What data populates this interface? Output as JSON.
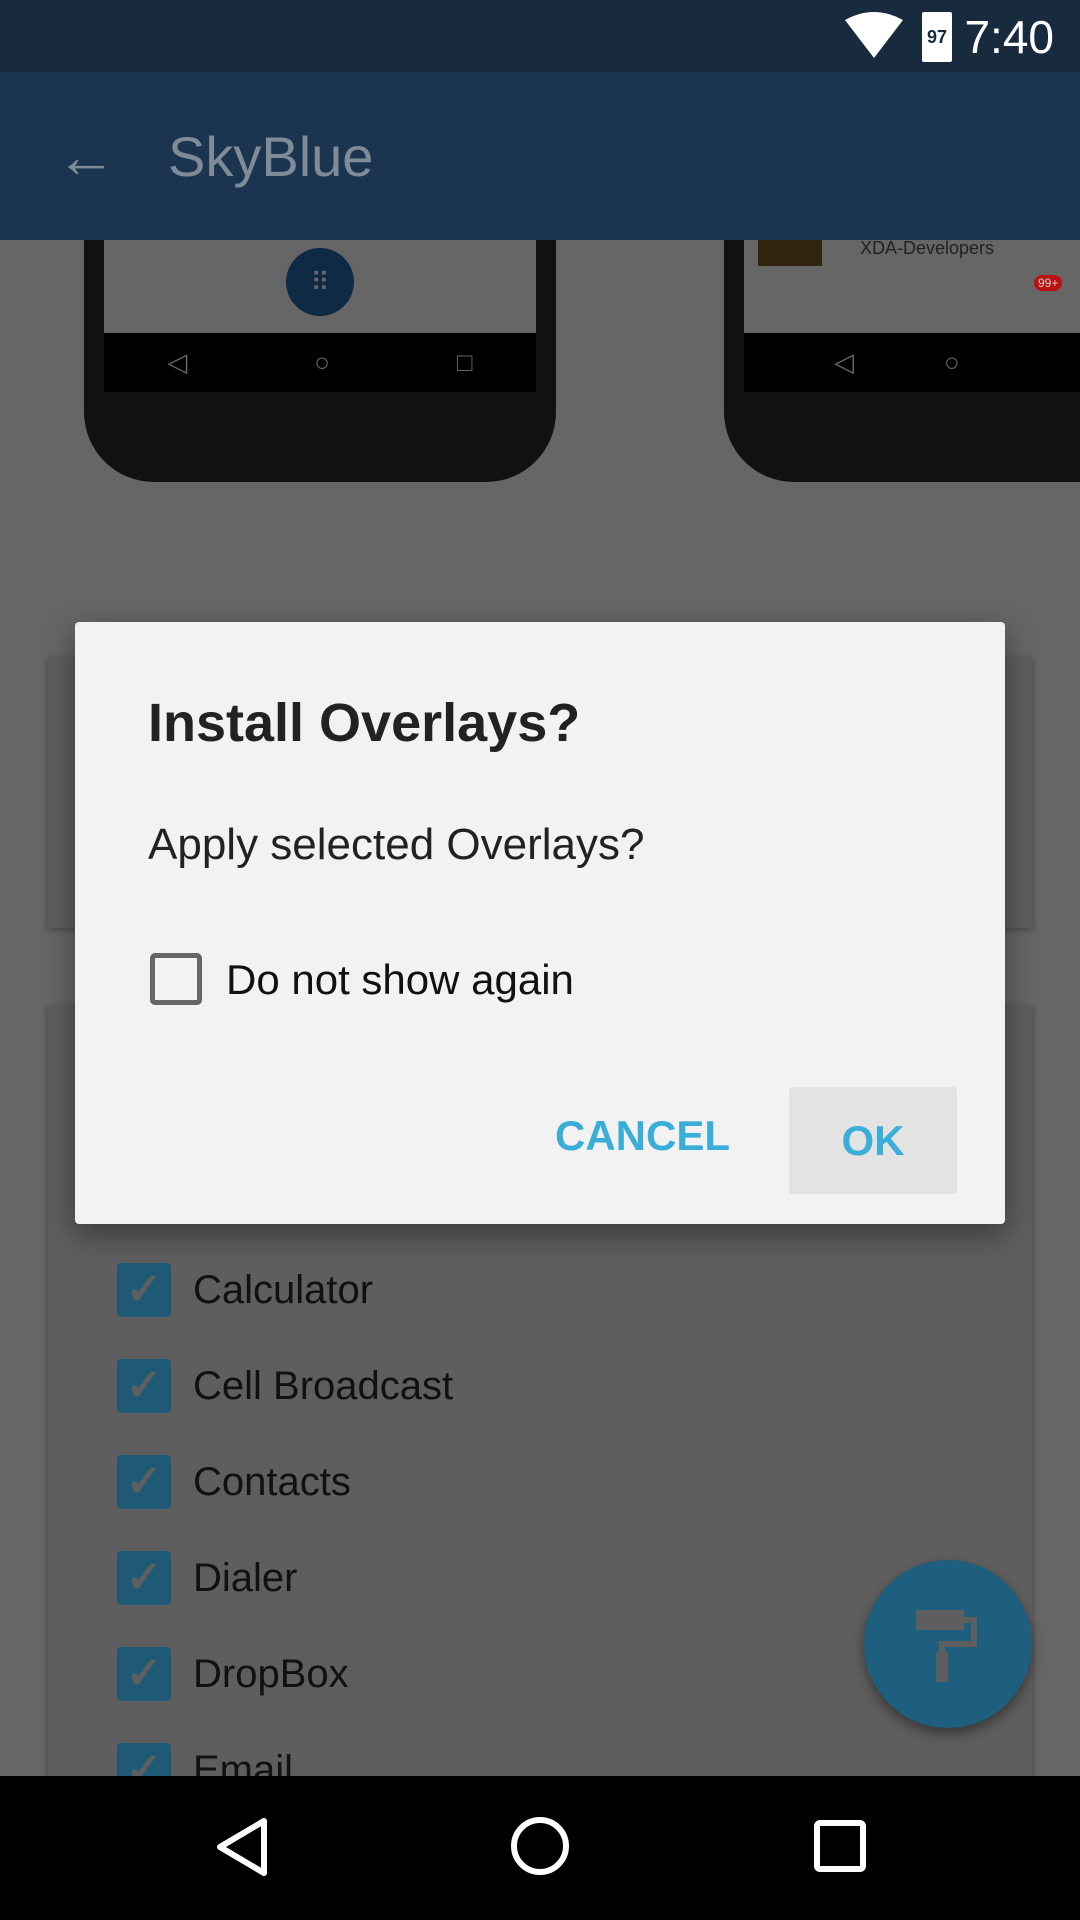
{
  "status_bar": {
    "time": "7:40",
    "battery": "97",
    "icons": [
      "wifi-icon",
      "battery-icon"
    ]
  },
  "app_bar": {
    "title": "SkyBlue",
    "back_icon": "arrow-left-icon"
  },
  "preview": {
    "right_app_label": "XDA-Developers",
    "badge": "99+"
  },
  "list": {
    "items": [
      {
        "label": "Calculator",
        "checked": true
      },
      {
        "label": "Cell Broadcast",
        "checked": true
      },
      {
        "label": "Contacts",
        "checked": true
      },
      {
        "label": "Dialer",
        "checked": true
      },
      {
        "label": "DropBox",
        "checked": true
      },
      {
        "label": "Email",
        "checked": true
      }
    ]
  },
  "fab": {
    "icon": "paint-roller-icon"
  },
  "dialog": {
    "title": "Install Overlays?",
    "message": "Apply selected Overlays?",
    "checkbox_label": "Do not show again",
    "checkbox_checked": false,
    "cancel_label": "CANCEL",
    "ok_label": "OK"
  },
  "colors": {
    "accent": "#3aaed8",
    "app_bar": "#1b3550",
    "status_bar": "#172a3e"
  }
}
